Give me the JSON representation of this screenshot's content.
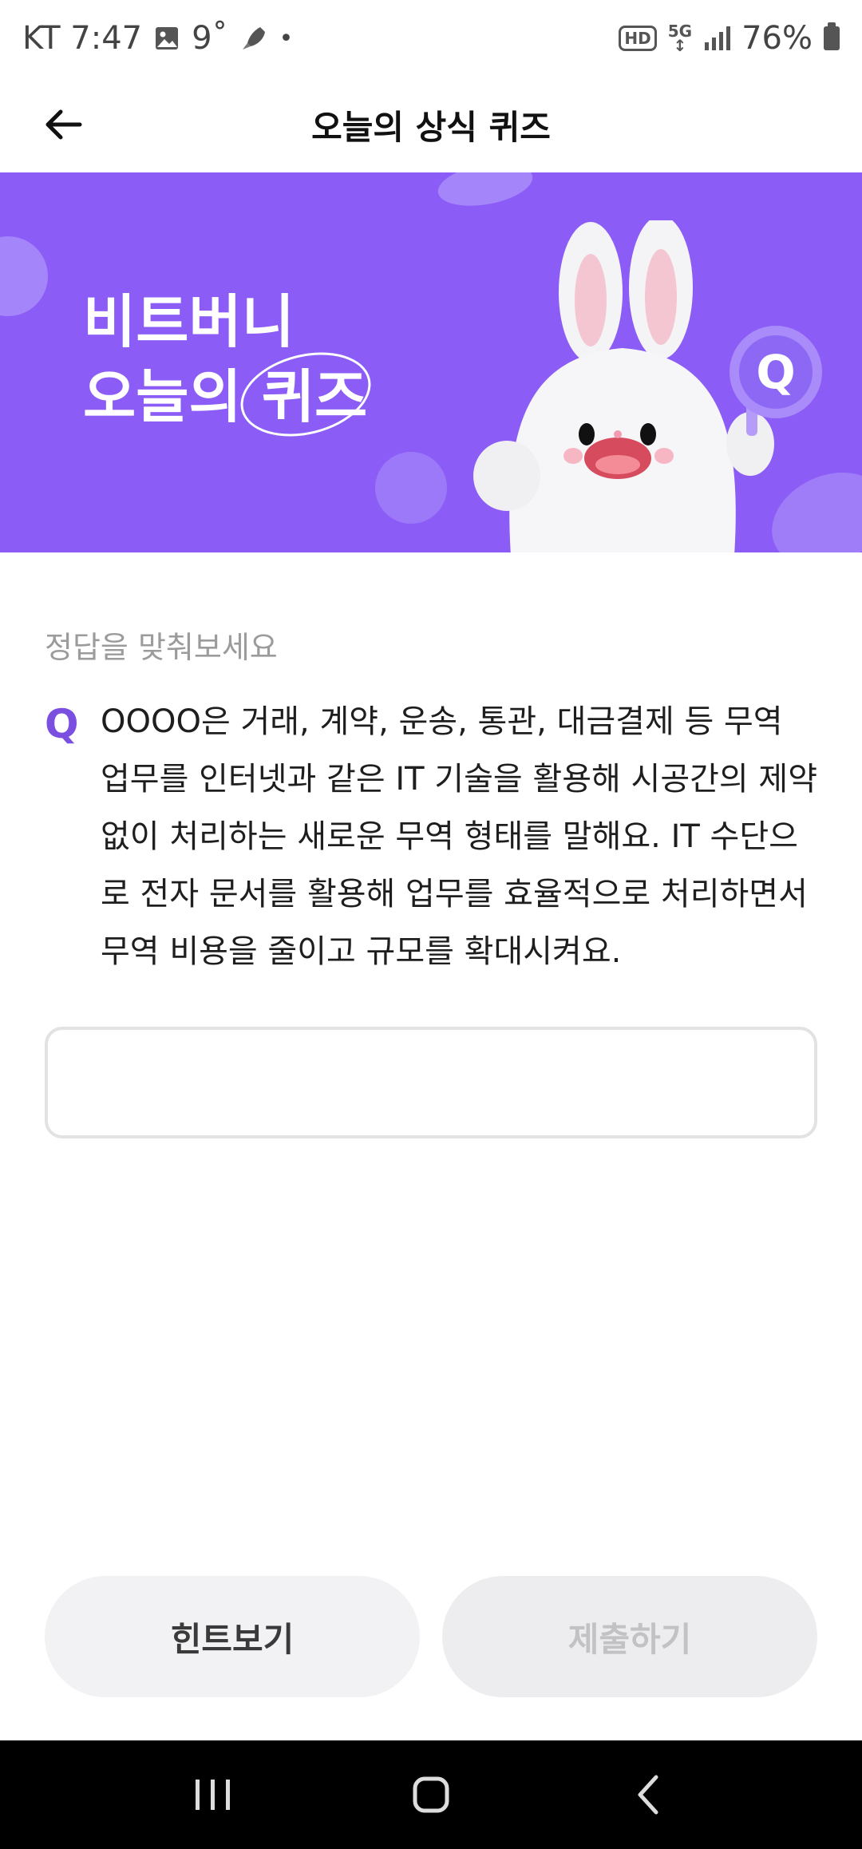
{
  "status_bar": {
    "carrier_time": "KT 7:47",
    "temperature": "9˚",
    "dot": "•",
    "hd": "HD",
    "network": "5G",
    "battery": "76%"
  },
  "app_bar": {
    "title": "오늘의 상식 퀴즈"
  },
  "banner": {
    "line1": "비트버니",
    "line2_prefix": "오늘의",
    "line2_emphasis": "퀴즈",
    "sign_letter": "Q",
    "brand_color": "#8b5cf6"
  },
  "quiz": {
    "instruction": "정답을 맞춰보세요",
    "q_mark": "Q",
    "question": "OOOO은 거래, 계약, 운송, 통관, 대금결제 등 무역 업무를 인터넷과 같은 IT 기술을 활용해 시공간의 제약 없이 처리하는 새로운 무역 형태를 말해요. IT 수단으로 전자 문서를 활용해 업무를 효율적으로 처리하면서 무역 비용을 줄이고 규모를 확대시켜요.",
    "answer_value": "",
    "answer_placeholder": ""
  },
  "buttons": {
    "hint": "힌트보기",
    "submit": "제출하기"
  },
  "icons": {
    "back": "arrow-left-icon",
    "nav_recent": "recent-apps-icon",
    "nav_home": "home-icon",
    "nav_back": "chevron-left-icon"
  }
}
